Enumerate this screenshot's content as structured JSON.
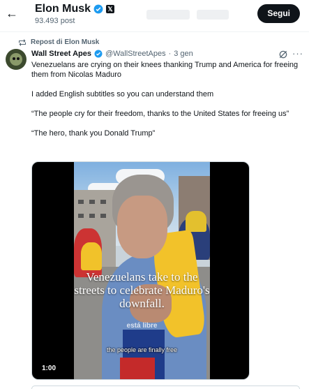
{
  "header": {
    "name": "Elon Musk",
    "post_count": "93.493 post",
    "follow_label": "Segui",
    "x_badge": "𝕏",
    "verified_color": "#1d9bf0"
  },
  "repost": {
    "label": "Repost di Elon Musk"
  },
  "tweet": {
    "display_name": "Wall Street Apes",
    "handle": "@WallStreetApes",
    "separator": "·",
    "time": "3 gen",
    "more": "···",
    "paragraphs": [
      "Venezuelans are crying on their knees thanking Trump and America for freeing them from Nicolas Maduro",
      "I added English subtitles so you can understand them",
      "“The people cry for their freedom, thanks to the United States for freeing us”",
      "“The hero, thank you Donald Trump”"
    ]
  },
  "video": {
    "overlay_text": "Venezuelans take to the streets to celebrate Maduro's downfall.",
    "faint_text": "está libre",
    "subtitle": "the people are finally free",
    "duration": "1:00"
  },
  "icons": {
    "back": "arrow-left-icon",
    "verified": "verified-badge-icon",
    "repost": "repost-icon",
    "grok": "grok-icon",
    "more": "more-icon"
  }
}
